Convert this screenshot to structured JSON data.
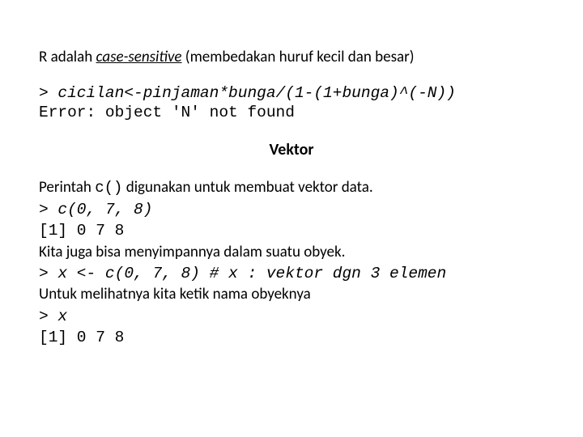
{
  "intro": {
    "prefix": "R adalah ",
    "emphasis": "case-sensitive",
    "suffix": " (membedakan huruf kecil dan besar)"
  },
  "code_example_1": {
    "line1": "> cicilan<-pinjaman*bunga/(1-(1+bunga)^(-N))",
    "line2": "Error: object 'N' not found"
  },
  "section_title": "Vektor",
  "vector_section": {
    "para1_prefix": "Perintah ",
    "para1_code": "c()",
    "para1_suffix": " digunakan untuk membuat vektor data.",
    "code_line1": "> c(0, 7, 8)",
    "code_line2": "[1] 0 7 8",
    "para2": "Kita juga bisa menyimpannya dalam suatu obyek.",
    "code_line3": "> x <- c(0, 7, 8) # x : vektor dgn 3 elemen",
    "para3": "Untuk melihatnya kita ketik nama obyeknya",
    "code_line4": "> x",
    "code_line5": "[1] 0 7 8"
  }
}
